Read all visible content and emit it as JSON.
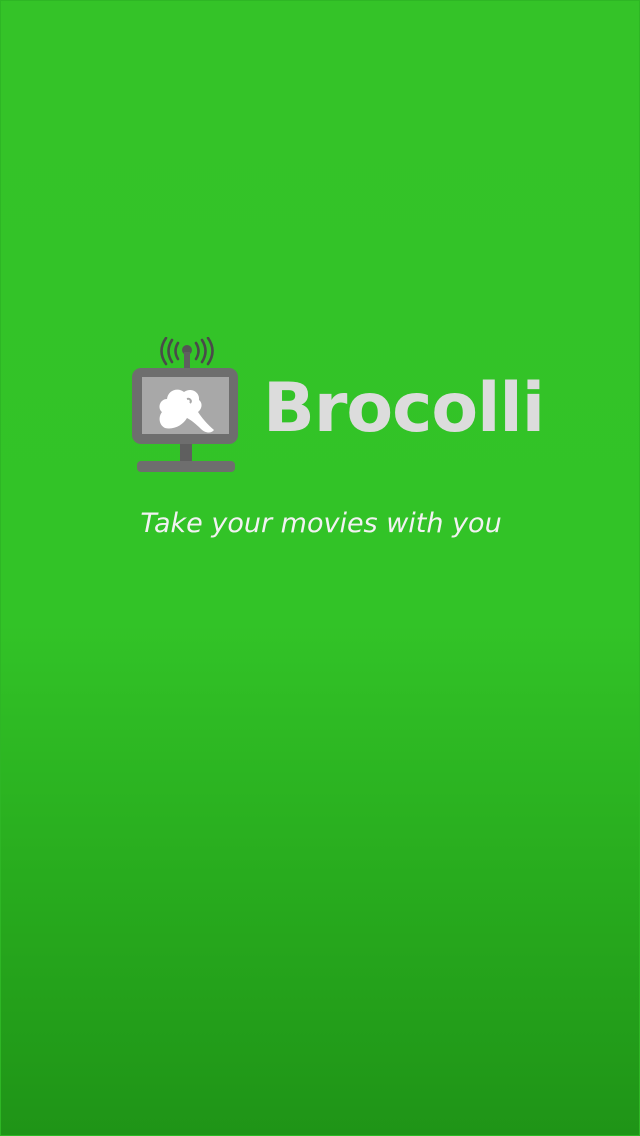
{
  "app": {
    "name": "Brocolli",
    "tagline": "Take your movies with you"
  },
  "logo": {
    "icon": "tv-broadcast-broccoli-icon"
  },
  "colors": {
    "background_top": "#34c328",
    "background_bottom": "#1f9417",
    "logo_gray": "#6e6e6e",
    "screen_gray": "#a8a8a8",
    "app_name_text": "#dcdcdc",
    "tagline_text": "#f2f2f2"
  }
}
